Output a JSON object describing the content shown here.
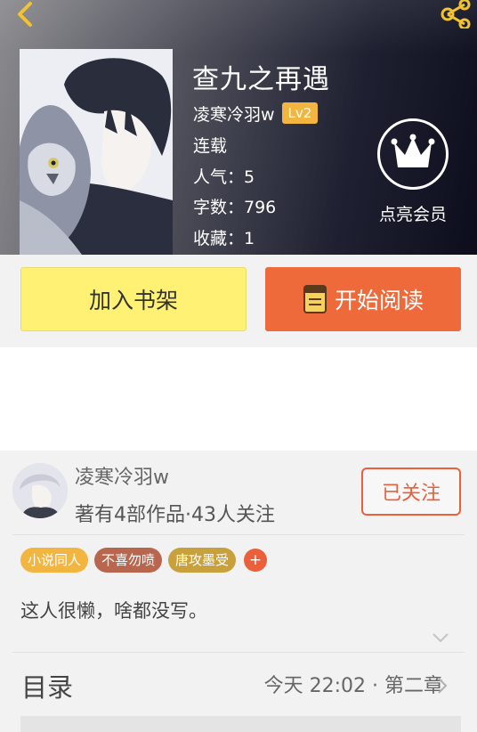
{
  "header": {
    "back_icon": "chevron-left-icon",
    "share_icon": "share-icon",
    "accent_color": "#f2c230"
  },
  "book": {
    "title": "查九之再遇",
    "author": "凌寒冷羽w",
    "level_badge": "Lv2",
    "status": "连载",
    "popularity": "人气：5",
    "word_count": "字数：796",
    "favorites": "收藏：1"
  },
  "vip": {
    "icon": "crown-icon",
    "label": "点亮会员"
  },
  "actions": {
    "add_shelf_label": "加入书架",
    "start_read_label": "开始阅读",
    "shelf_color": "#fff174",
    "read_color": "#ee6a3a"
  },
  "author_section": {
    "name": "凌寒冷羽w",
    "subtitle": "著有4部作品·43人关注",
    "follow_label": "已关注",
    "tags": [
      {
        "label": "小说同人",
        "color": "#f2b640"
      },
      {
        "label": "不喜勿喷",
        "color": "#b8664e"
      },
      {
        "label": "唐攻墨受",
        "color": "#c9a13c"
      }
    ],
    "add_tag_label": "+",
    "intro": "这人很懒，啥都没写。"
  },
  "toc": {
    "label": "目录",
    "latest_update": "今天 22:02 · 第二章"
  }
}
